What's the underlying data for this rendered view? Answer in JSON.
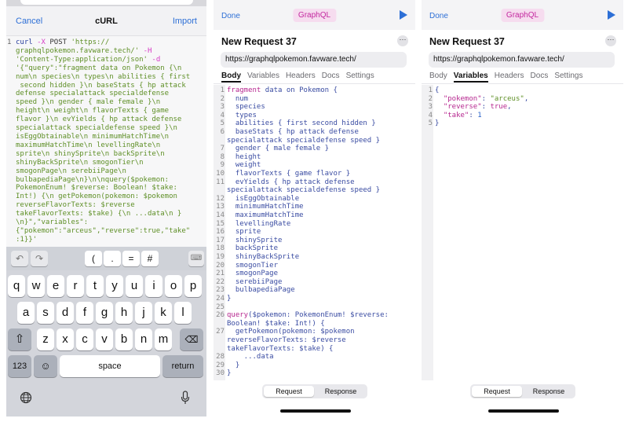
{
  "curl_panel": {
    "cancel_label": "Cancel",
    "title": "cURL",
    "import_label": "Import",
    "line_number": "1",
    "command": "curl",
    "option_x": "-X",
    "method": "POST",
    "url_part1": "'https://",
    "url_part2": "graphqlpokemon.favware.tech/'",
    "option_h": "-H",
    "header": "'Content-Type:application/json'",
    "option_d": "-d",
    "body_lines": [
      "'{\"query\":\"fragment data on Pokemon {\\n",
      "num\\n species\\n types\\n abilities { first",
      " second hidden }\\n baseStats { hp attack",
      "defense specialattack specialdefense",
      "speed }\\n gender { male female }\\n",
      "height\\n weight\\n flavorTexts { game",
      "flavor }\\n evYields { hp attack defense",
      "specialattack specialdefense speed }\\n",
      "isEggObtainable\\n minimumHatchTime\\n",
      "maximumHatchTime\\n levellingRate\\n",
      "sprite\\n shinySprite\\n backSprite\\n",
      "shinyBackSprite\\n smogonTier\\n",
      "smogonPage\\n serebiiPage\\n",
      "bulbapediaPage\\n}\\n\\nquery($pokemon:",
      "PokemonEnum! $reverse: Boolean! $take:",
      "Int!) {\\n getPokemon(pokemon: $pokemon",
      "reverseFlavorTexts: $reverse",
      "takeFlavorTexts: $take) {\\n ...data\\n }",
      "\\n}\",\"variables\":",
      "{\"pokemon\":\"arceus\",\"reverse\":true,\"take\"",
      ":1}}'"
    ],
    "toolbar": [
      "(",
      ".",
      "=",
      "#"
    ],
    "keyboard": {
      "row1": [
        "q",
        "w",
        "e",
        "r",
        "t",
        "y",
        "u",
        "i",
        "o",
        "p"
      ],
      "row2": [
        "a",
        "s",
        "d",
        "f",
        "g",
        "h",
        "j",
        "k",
        "l"
      ],
      "row3": [
        "z",
        "x",
        "c",
        "v",
        "b",
        "n",
        "m"
      ],
      "numbers_label": "123",
      "space_label": "space",
      "return_label": "return"
    }
  },
  "graphql": {
    "done_label": "Done",
    "badge": "GraphQL",
    "request_name": "New Request 37",
    "more_label": "···",
    "url": "https://graphqlpokemon.favware.tech/",
    "tabs": [
      "Body",
      "Variables",
      "Headers",
      "Docs",
      "Settings"
    ],
    "segment": [
      "Request",
      "Response"
    ]
  },
  "body_code": {
    "line_numbers": [
      "1",
      "2",
      "3",
      "4",
      "5",
      "6",
      "",
      "7",
      "8",
      "9",
      "10",
      "11",
      "",
      "12",
      "13",
      "14",
      "15",
      "16",
      "17",
      "18",
      "19",
      "20",
      "21",
      "22",
      "23",
      "24",
      "25",
      "26",
      "",
      "27",
      "",
      "",
      "28",
      "29",
      "30"
    ],
    "l1_kw": "fragment",
    "l1_rest": " data on Pokemon {",
    "fields": [
      "  num",
      "  species",
      "  types",
      "  abilities { first second hidden }",
      "  baseStats { hp attack defense",
      "specialattack specialdefense speed }",
      "  gender { male female }",
      "  height",
      "  weight",
      "  flavorTexts { game flavor }",
      "  evYields { hp attack defense",
      "specialattack specialdefense speed }",
      "  isEggObtainable",
      "  minimumHatchTime",
      "  maximumHatchTime",
      "  levellingRate",
      "  sprite",
      "  shinySprite",
      "  backSprite",
      "  shinyBackSprite",
      "  smogonTier",
      "  smogonPage",
      "  serebiiPage",
      "  bulbapediaPage",
      "}"
    ],
    "l25": "",
    "q1_kw": "query",
    "q1_rest": "($pokemon: PokemonEnum! $reverse:",
    "q2": "Boolean! $take: Int!) {",
    "q3": "  getPokemon(pokemon: $pokemon",
    "q4": "reverseFlavorTexts: $reverse",
    "q5": "takeFlavorTexts: $take) {",
    "q6": "    ...data",
    "q7": "  }",
    "q8": "}"
  },
  "variables_code": {
    "line_numbers": [
      "1",
      "2",
      "3",
      "4",
      "5"
    ],
    "l1": "{",
    "pokemon_key": "\"pokemon\"",
    "pokemon_val": "\"arceus\"",
    "reverse_key": "\"reverse\"",
    "reverse_val": "true",
    "take_key": "\"take\"",
    "take_val": "1",
    "l5": "}"
  }
}
